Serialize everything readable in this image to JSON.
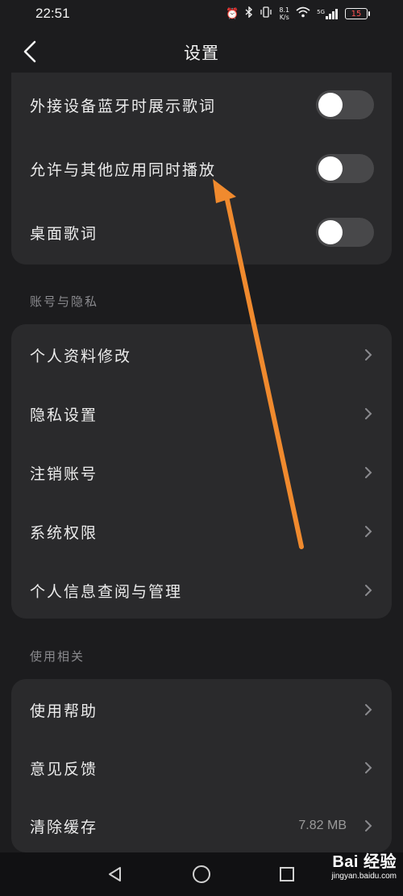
{
  "status_bar": {
    "time": "22:51",
    "net_speed_value": "8.1",
    "net_speed_unit": "K/s",
    "signal_label": "5G",
    "battery": "15",
    "icons": [
      "alarm-icon",
      "bluetooth-icon",
      "vibrate-icon",
      "wifi-icon",
      "signal-icon",
      "battery-icon"
    ]
  },
  "header": {
    "title": "设置",
    "back_icon": "chevron-left-icon"
  },
  "top_group": {
    "items": [
      {
        "label": "外接设备蓝牙时展示歌词",
        "toggle": false
      },
      {
        "label": "允许与其他应用同时播放",
        "toggle": false
      },
      {
        "label": "桌面歌词",
        "toggle": false
      }
    ]
  },
  "account_section": {
    "title": "账号与隐私",
    "items": [
      {
        "label": "个人资料修改"
      },
      {
        "label": "隐私设置"
      },
      {
        "label": "注销账号"
      },
      {
        "label": "系统权限"
      },
      {
        "label": "个人信息查阅与管理"
      }
    ]
  },
  "usage_section": {
    "title": "使用相关",
    "items": [
      {
        "label": "使用帮助",
        "value": ""
      },
      {
        "label": "意见反馈",
        "value": ""
      },
      {
        "label": "清除缓存",
        "value": "7.82 MB"
      }
    ]
  },
  "annotation": {
    "color": "#f08a2e",
    "icon": "arrow-up-icon"
  },
  "system_nav": {
    "keys": [
      "back-triangle-icon",
      "home-circle-icon",
      "recents-square-icon"
    ]
  },
  "watermark": {
    "main": "Bai 经验",
    "sub": "jingyan.baidu.com"
  },
  "colors": {
    "background": "#1c1c1e",
    "card": "#2a2a2c",
    "toggle_off": "#48484a",
    "section_title": "#8a8a8e"
  }
}
